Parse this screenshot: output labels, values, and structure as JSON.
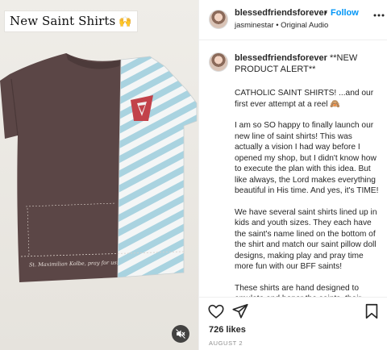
{
  "media": {
    "overlay_text": "New Saint Shirts",
    "overlay_emoji": "🙌",
    "shirt_print_text": "St. Maximilian Kolbe, pray for us!",
    "mute_icon": "muted-speaker-icon"
  },
  "header": {
    "username": "blessedfriendsforever",
    "separator": "•",
    "follow_label": "Follow",
    "audio_line": "jasminestar • Original Audio",
    "more_icon": "ellipsis-icon"
  },
  "caption": {
    "username": "blessedfriendsforever",
    "headline": "**NEW PRODUCT ALERT**",
    "paragraphs": [
      "CATHOLIC SAINT SHIRTS! ...and our first ever attempt at a reel 🙈",
      "I am so SO happy to finally launch our new line of saint shirts! This was actually a vision I had way before I opened my shop, but I didn't know how to execute the plan with this idea. But like always, the Lord makes everything beautiful in His time. And yes, it's TIME!",
      "We have several saint shirts lined up in kids and youth sizes. They each have the saint's name lined on the bottom of the shirt and match our saint pillow doll designs, making play and pray time more fun with our BFF saints!",
      "These shirts are hand designed to emulate and honor the saints. their"
    ]
  },
  "actions": {
    "like_icon": "heart-icon",
    "share_icon": "paper-plane-icon",
    "save_icon": "bookmark-icon",
    "likes_text": "726 likes",
    "date_text": "AUGUST 2"
  },
  "colors": {
    "follow_blue": "#0095f6",
    "shirt_brown": "#5b4646",
    "stripe_blue": "#a9d3e0",
    "patch_red": "#c2424a"
  }
}
